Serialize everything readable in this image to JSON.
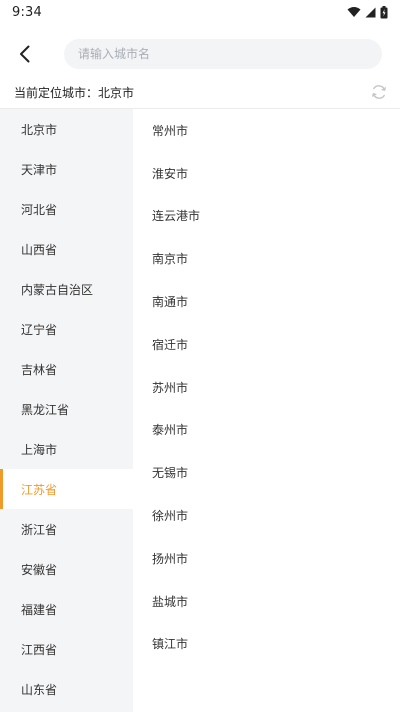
{
  "status_bar": {
    "time": "9:34",
    "icons": [
      "wifi-icon",
      "signal-icon",
      "battery-icon"
    ]
  },
  "header": {
    "back_icon": "chevron-left-icon",
    "search_placeholder": "请输入城市名"
  },
  "location": {
    "text": "当前定位城市：北京市",
    "refresh_icon": "refresh-icon"
  },
  "provinces": [
    {
      "label": "北京市",
      "active": false
    },
    {
      "label": "天津市",
      "active": false
    },
    {
      "label": "河北省",
      "active": false
    },
    {
      "label": "山西省",
      "active": false
    },
    {
      "label": "内蒙古自治区",
      "active": false
    },
    {
      "label": "辽宁省",
      "active": false
    },
    {
      "label": "吉林省",
      "active": false
    },
    {
      "label": "黑龙江省",
      "active": false
    },
    {
      "label": "上海市",
      "active": false
    },
    {
      "label": "江苏省",
      "active": true
    },
    {
      "label": "浙江省",
      "active": false
    },
    {
      "label": "安徽省",
      "active": false
    },
    {
      "label": "福建省",
      "active": false
    },
    {
      "label": "江西省",
      "active": false
    },
    {
      "label": "山东省",
      "active": false
    }
  ],
  "cities": [
    "常州市",
    "淮安市",
    "连云港市",
    "南京市",
    "南通市",
    "宿迁市",
    "苏州市",
    "泰州市",
    "无锡市",
    "徐州市",
    "扬州市",
    "盐城市",
    "镇江市"
  ],
  "colors": {
    "accent": "#f09a2a",
    "sidebar_bg": "#f4f5f7",
    "search_bg": "#f3f4f6"
  }
}
